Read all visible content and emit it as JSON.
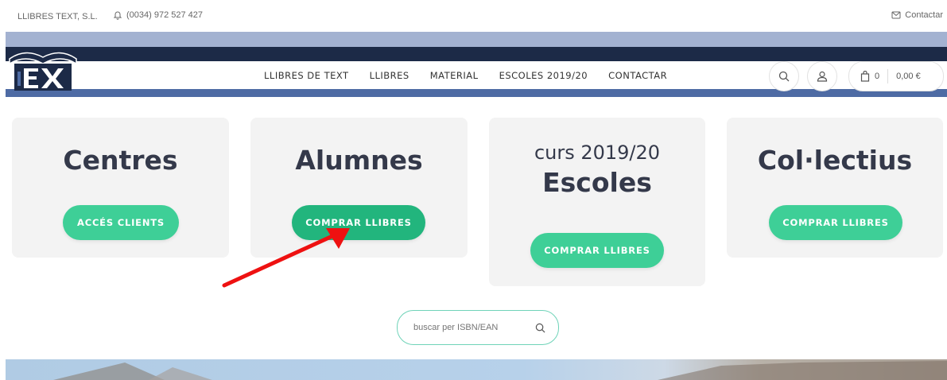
{
  "topbar": {
    "company": "LLIBRES TEXT, S.L.",
    "phone": "(0034) 972 527 427",
    "contact": "Contactar"
  },
  "nav": {
    "items": [
      "LLIBRES DE TEXT",
      "LLIBRES",
      "MATERIAL",
      "ESCOLES 2019/20",
      "CONTACTAR"
    ]
  },
  "cart": {
    "count": "0",
    "total": "0,00 €"
  },
  "cards": {
    "centres": {
      "title": "Centres",
      "button": "ACCÉS CLIENTS"
    },
    "alumnes": {
      "title": "Alumnes",
      "button": "COMPRAR LLIBRES"
    },
    "escoles": {
      "subtitle": "curs 2019/20",
      "title": "Escoles",
      "button": "COMPRAR LLIBRES"
    },
    "collectius": {
      "title": "Col·lectius",
      "button": "COMPRAR LLIBRES"
    }
  },
  "search": {
    "placeholder": "buscar per ISBN/EAN"
  },
  "colors": {
    "accent": "#3ecf97",
    "accent_active": "#22b57d",
    "navy": "#1c2a47",
    "band": "#a3b2d1",
    "arrow": "#ee1111"
  },
  "icons": {
    "phone": "bell-icon",
    "contact": "mail-icon",
    "search": "search-icon",
    "account": "user-icon",
    "cart": "bag-icon"
  }
}
